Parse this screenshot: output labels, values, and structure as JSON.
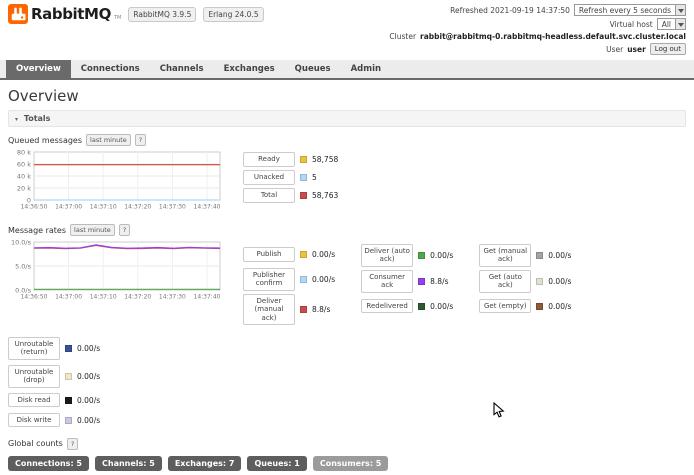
{
  "header": {
    "logo": {
      "brand": "RabbitMQ",
      "tm": "TM"
    },
    "badges": [
      {
        "label": "RabbitMQ 3.9.5"
      },
      {
        "label": "Erlang 24.0.5"
      }
    ],
    "refreshed_label": "Refreshed 2021-09-19 14:37:50",
    "refresh_interval": "Refresh every 5 seconds",
    "virtual_host_label": "Virtual host",
    "virtual_host_value": "All",
    "cluster_label": "Cluster",
    "cluster_value": "rabbit@rabbitmq-0.rabbitmq-headless.default.svc.cluster.local",
    "user_label": "User",
    "user_name": "user",
    "logout": "Log out"
  },
  "nav": {
    "tabs": [
      "Overview",
      "Connections",
      "Channels",
      "Exchanges",
      "Queues",
      "Admin"
    ],
    "active": "Overview"
  },
  "page": {
    "title": "Overview"
  },
  "totals": {
    "label": "Totals",
    "collapse_icon": "▾"
  },
  "queued": {
    "heading": "Queued messages",
    "mode_button": "last minute",
    "help_button": "?",
    "legend": [
      {
        "label": "Ready",
        "color": "#edc240",
        "value": "58,758"
      },
      {
        "label": "Unacked",
        "color": "#afd8f8",
        "value": "5"
      },
      {
        "label": "Total",
        "color": "#cb4b4b",
        "value": "58,763"
      }
    ]
  },
  "rates": {
    "heading": "Message rates",
    "mode_button": "last minute",
    "help_button": "?",
    "columns": [
      [
        {
          "label": "Publish",
          "color": "#edc240",
          "value": "0.00/s"
        },
        {
          "label": "Publisher confirm",
          "color": "#afd8f8",
          "value": "0.00/s"
        },
        {
          "label": "Deliver (manual ack)",
          "color": "#cb4b4b",
          "value": "8.8/s"
        }
      ],
      [
        {
          "label": "Deliver (auto ack)",
          "color": "#4da74d",
          "value": "0.00/s"
        },
        {
          "label": "Consumer ack",
          "color": "#9440ed",
          "value": "8.8/s"
        },
        {
          "label": "Redelivered",
          "color": "#2d5a2d",
          "value": "0.00/s"
        }
      ],
      [
        {
          "label": "Get (manual ack)",
          "color": "#a3a3a3",
          "value": "0.00/s"
        },
        {
          "label": "Get (auto ack)",
          "color": "#e0e0d1",
          "value": "0.00/s"
        },
        {
          "label": "Get (empty)",
          "color": "#8a5a3b",
          "value": "0.00/s"
        }
      ]
    ],
    "extra": [
      {
        "label": "Unroutable (return)",
        "color": "#38539b",
        "value": "0.00/s"
      },
      {
        "label": "Unroutable (drop)",
        "color": "#efe8c8",
        "value": "0.00/s"
      },
      {
        "label": "Disk read",
        "color": "#1a1a1a",
        "value": "0.00/s"
      },
      {
        "label": "Disk write",
        "color": "#cdc4e6",
        "value": "0.00/s"
      }
    ]
  },
  "global_counts": {
    "heading": "Global counts",
    "help_button": "?"
  },
  "footer": {
    "badges": [
      {
        "text": "Connections: 5"
      },
      {
        "text": "Channels: 5"
      },
      {
        "text": "Exchanges: 7"
      },
      {
        "text": "Queues: 1"
      },
      {
        "text": "Consumers: 5"
      }
    ]
  },
  "chart_data": [
    {
      "id": "queued-chart",
      "type": "line",
      "title": "Queued messages (last minute)",
      "x_ticks": [
        "14:36:50",
        "14:37:00",
        "14:37:10",
        "14:37:20",
        "14:37:30",
        "14:37:40"
      ],
      "y_ticks": [
        "80 k",
        "60 k",
        "40 k",
        "20 k",
        "0"
      ],
      "ylim": [
        0,
        80000
      ],
      "series": [
        {
          "name": "Ready",
          "color": "#edc240",
          "values": [
            58758,
            58758,
            58758,
            58758,
            58758,
            58758,
            58758,
            58758,
            58758,
            58758,
            58758,
            58758,
            58758
          ]
        },
        {
          "name": "Unacked",
          "color": "#afd8f8",
          "values": [
            5,
            5,
            5,
            5,
            5,
            5,
            5,
            5,
            5,
            5,
            5,
            5,
            5
          ]
        },
        {
          "name": "Total",
          "color": "#cb4b4b",
          "values": [
            58763,
            58763,
            58763,
            58763,
            58763,
            58763,
            58763,
            58763,
            58763,
            58763,
            58763,
            58763,
            58763
          ]
        }
      ]
    },
    {
      "id": "rates-chart",
      "type": "line",
      "title": "Message rates (last minute)",
      "x_ticks": [
        "14:36:50",
        "14:37:00",
        "14:37:10",
        "14:37:20",
        "14:37:30",
        "14:37:40"
      ],
      "y_ticks": [
        "10.0/s",
        "5.0/s",
        "0.0/s"
      ],
      "ylim": [
        0,
        10
      ],
      "series": [
        {
          "name": "Deliver (manual ack)",
          "color": "#cb4b4b",
          "values": [
            8.7,
            8.75,
            8.6,
            8.7,
            9.3,
            8.8,
            8.6,
            8.65,
            8.75,
            8.6,
            8.8,
            8.7,
            8.65
          ]
        },
        {
          "name": "Deliver (auto ack)",
          "color": "#4da74d",
          "values": [
            0.15,
            0.15,
            0.15,
            0.15,
            0.15,
            0.15,
            0.15,
            0.15,
            0.15,
            0.15,
            0.15,
            0.15,
            0.15
          ]
        },
        {
          "name": "Consumer ack",
          "color": "#9440ed",
          "values": [
            8.8,
            8.85,
            8.7,
            8.8,
            9.4,
            8.9,
            8.7,
            8.75,
            8.85,
            8.7,
            8.9,
            8.8,
            8.75
          ]
        }
      ]
    }
  ]
}
